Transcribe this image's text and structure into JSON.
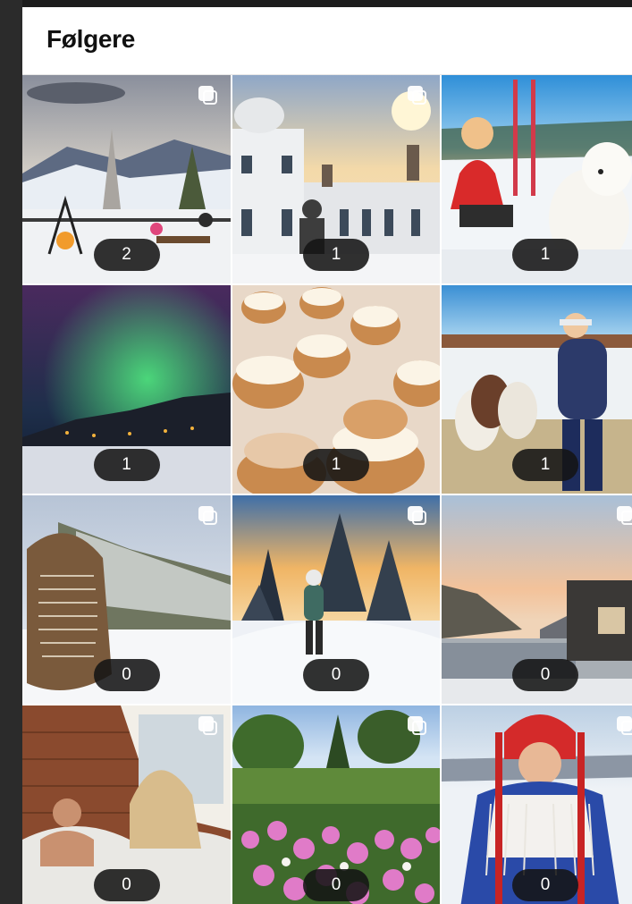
{
  "header": {
    "title": "Følgere"
  },
  "grid": {
    "tiles": [
      {
        "subject": "campfire-on-snowy-terrace",
        "count": "2",
        "multi": true
      },
      {
        "subject": "white-manor-at-sunset",
        "count": "1",
        "multi": true
      },
      {
        "subject": "girl-with-white-dog-in-snow",
        "count": "1",
        "multi": false
      },
      {
        "subject": "northern-lights-over-village",
        "count": "1",
        "multi": false
      },
      {
        "subject": "cream-buns-pastries",
        "count": "1",
        "multi": false
      },
      {
        "subject": "woman-with-alpacas",
        "count": "1",
        "multi": false
      },
      {
        "subject": "memorial-stone-in-snow",
        "count": "0",
        "multi": true
      },
      {
        "subject": "skier-in-snowy-forest",
        "count": "0",
        "multi": true
      },
      {
        "subject": "fjord-cabin-at-dusk",
        "count": "0",
        "multi": true
      },
      {
        "subject": "couple-in-cabin-bed",
        "count": "0",
        "multi": true
      },
      {
        "subject": "garden-with-pink-flowers",
        "count": "0",
        "multi": true
      },
      {
        "subject": "woman-in-sami-costume",
        "count": "0",
        "multi": true
      }
    ]
  }
}
